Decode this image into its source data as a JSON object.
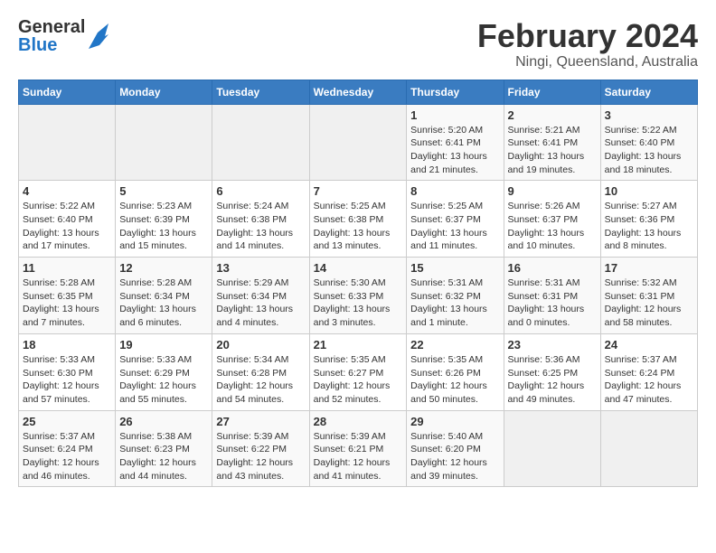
{
  "logo": {
    "general": "General",
    "blue": "Blue"
  },
  "title": "February 2024",
  "subtitle": "Ningi, Queensland, Australia",
  "days_of_week": [
    "Sunday",
    "Monday",
    "Tuesday",
    "Wednesday",
    "Thursday",
    "Friday",
    "Saturday"
  ],
  "weeks": [
    [
      {
        "day": "",
        "info": ""
      },
      {
        "day": "",
        "info": ""
      },
      {
        "day": "",
        "info": ""
      },
      {
        "day": "",
        "info": ""
      },
      {
        "day": "1",
        "info": "Sunrise: 5:20 AM\nSunset: 6:41 PM\nDaylight: 13 hours\nand 21 minutes."
      },
      {
        "day": "2",
        "info": "Sunrise: 5:21 AM\nSunset: 6:41 PM\nDaylight: 13 hours\nand 19 minutes."
      },
      {
        "day": "3",
        "info": "Sunrise: 5:22 AM\nSunset: 6:40 PM\nDaylight: 13 hours\nand 18 minutes."
      }
    ],
    [
      {
        "day": "4",
        "info": "Sunrise: 5:22 AM\nSunset: 6:40 PM\nDaylight: 13 hours\nand 17 minutes."
      },
      {
        "day": "5",
        "info": "Sunrise: 5:23 AM\nSunset: 6:39 PM\nDaylight: 13 hours\nand 15 minutes."
      },
      {
        "day": "6",
        "info": "Sunrise: 5:24 AM\nSunset: 6:38 PM\nDaylight: 13 hours\nand 14 minutes."
      },
      {
        "day": "7",
        "info": "Sunrise: 5:25 AM\nSunset: 6:38 PM\nDaylight: 13 hours\nand 13 minutes."
      },
      {
        "day": "8",
        "info": "Sunrise: 5:25 AM\nSunset: 6:37 PM\nDaylight: 13 hours\nand 11 minutes."
      },
      {
        "day": "9",
        "info": "Sunrise: 5:26 AM\nSunset: 6:37 PM\nDaylight: 13 hours\nand 10 minutes."
      },
      {
        "day": "10",
        "info": "Sunrise: 5:27 AM\nSunset: 6:36 PM\nDaylight: 13 hours\nand 8 minutes."
      }
    ],
    [
      {
        "day": "11",
        "info": "Sunrise: 5:28 AM\nSunset: 6:35 PM\nDaylight: 13 hours\nand 7 minutes."
      },
      {
        "day": "12",
        "info": "Sunrise: 5:28 AM\nSunset: 6:34 PM\nDaylight: 13 hours\nand 6 minutes."
      },
      {
        "day": "13",
        "info": "Sunrise: 5:29 AM\nSunset: 6:34 PM\nDaylight: 13 hours\nand 4 minutes."
      },
      {
        "day": "14",
        "info": "Sunrise: 5:30 AM\nSunset: 6:33 PM\nDaylight: 13 hours\nand 3 minutes."
      },
      {
        "day": "15",
        "info": "Sunrise: 5:31 AM\nSunset: 6:32 PM\nDaylight: 13 hours\nand 1 minute."
      },
      {
        "day": "16",
        "info": "Sunrise: 5:31 AM\nSunset: 6:31 PM\nDaylight: 13 hours\nand 0 minutes."
      },
      {
        "day": "17",
        "info": "Sunrise: 5:32 AM\nSunset: 6:31 PM\nDaylight: 12 hours\nand 58 minutes."
      }
    ],
    [
      {
        "day": "18",
        "info": "Sunrise: 5:33 AM\nSunset: 6:30 PM\nDaylight: 12 hours\nand 57 minutes."
      },
      {
        "day": "19",
        "info": "Sunrise: 5:33 AM\nSunset: 6:29 PM\nDaylight: 12 hours\nand 55 minutes."
      },
      {
        "day": "20",
        "info": "Sunrise: 5:34 AM\nSunset: 6:28 PM\nDaylight: 12 hours\nand 54 minutes."
      },
      {
        "day": "21",
        "info": "Sunrise: 5:35 AM\nSunset: 6:27 PM\nDaylight: 12 hours\nand 52 minutes."
      },
      {
        "day": "22",
        "info": "Sunrise: 5:35 AM\nSunset: 6:26 PM\nDaylight: 12 hours\nand 50 minutes."
      },
      {
        "day": "23",
        "info": "Sunrise: 5:36 AM\nSunset: 6:25 PM\nDaylight: 12 hours\nand 49 minutes."
      },
      {
        "day": "24",
        "info": "Sunrise: 5:37 AM\nSunset: 6:24 PM\nDaylight: 12 hours\nand 47 minutes."
      }
    ],
    [
      {
        "day": "25",
        "info": "Sunrise: 5:37 AM\nSunset: 6:24 PM\nDaylight: 12 hours\nand 46 minutes."
      },
      {
        "day": "26",
        "info": "Sunrise: 5:38 AM\nSunset: 6:23 PM\nDaylight: 12 hours\nand 44 minutes."
      },
      {
        "day": "27",
        "info": "Sunrise: 5:39 AM\nSunset: 6:22 PM\nDaylight: 12 hours\nand 43 minutes."
      },
      {
        "day": "28",
        "info": "Sunrise: 5:39 AM\nSunset: 6:21 PM\nDaylight: 12 hours\nand 41 minutes."
      },
      {
        "day": "29",
        "info": "Sunrise: 5:40 AM\nSunset: 6:20 PM\nDaylight: 12 hours\nand 39 minutes."
      },
      {
        "day": "",
        "info": ""
      },
      {
        "day": "",
        "info": ""
      }
    ]
  ]
}
